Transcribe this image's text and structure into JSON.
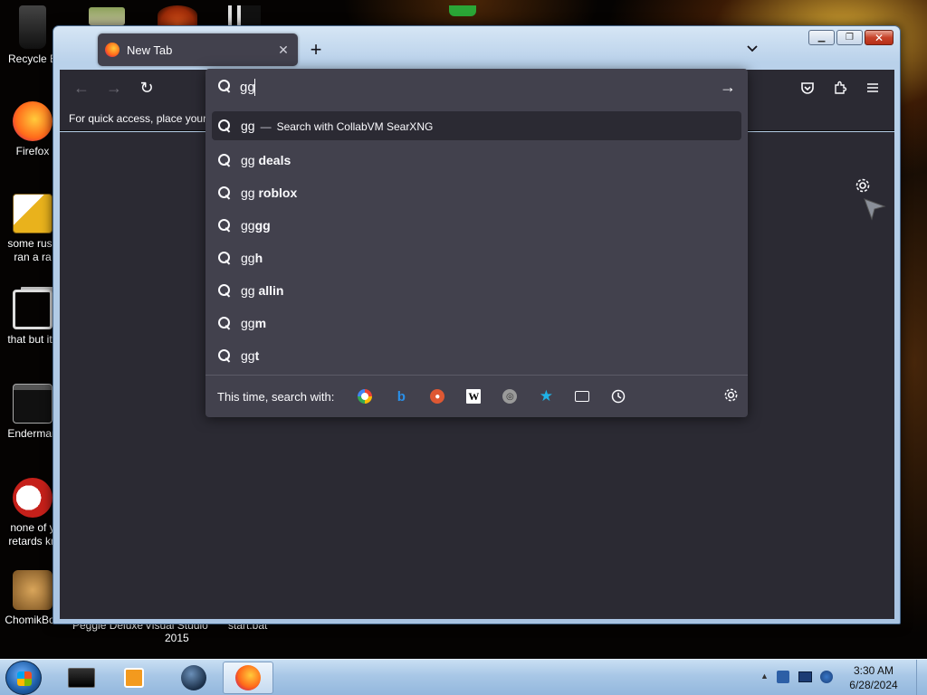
{
  "desktop": {
    "icons": [
      {
        "label_line1": "Recycle B",
        "label_line2": ""
      },
      {
        "label_line1": "Firefox",
        "label_line2": ""
      },
      {
        "label_line1": "some russ",
        "label_line2": "ran a ra"
      },
      {
        "label_line1": "that but its",
        "label_line2": ""
      },
      {
        "label_line1": "Enderman",
        "label_line2": ""
      },
      {
        "label_line1": "none of y",
        "label_line2": "retards kn"
      },
      {
        "label_line1": "ChomikBox",
        "label_line2": ""
      }
    ],
    "partial_labels": [
      "Peggle Deluxe",
      "Visual Studio",
      "2015",
      "start.bat"
    ]
  },
  "browser": {
    "tab_title": "New Tab",
    "tab_close": "✕",
    "new_tab": "+",
    "list_tabs": "⌄",
    "bookmarks_text": "For quick access, place your b",
    "nav": {
      "back": "←",
      "forward": "→",
      "reload": "↻"
    }
  },
  "urlbar": {
    "value": "gg",
    "go": "→",
    "results": [
      {
        "typed": "gg",
        "suffix": "",
        "dash": "—",
        "action": "Search with CollabVM SearXNG",
        "selected": true
      },
      {
        "typed": "gg ",
        "suffix": "deals"
      },
      {
        "typed": "gg ",
        "suffix": "roblox"
      },
      {
        "typed": "gg",
        "suffix": "gg"
      },
      {
        "typed": "gg",
        "suffix": "h"
      },
      {
        "typed": "gg ",
        "suffix": "allin"
      },
      {
        "typed": "gg",
        "suffix": "m"
      },
      {
        "typed": "gg",
        "suffix": "t"
      }
    ],
    "oneoff_label": "This time, search with:",
    "engines": [
      "google-icon",
      "bing-icon",
      "duckduckgo-icon",
      "wikipedia-icon",
      "searxng-icon",
      "bookmarks-star-icon",
      "tabs-icon",
      "history-icon"
    ]
  },
  "taskbar": {
    "time": "3:30 AM",
    "date": "6/28/2024",
    "tray_arrow": "▲"
  },
  "colors": {
    "toolbar": "#2b2a33",
    "popup": "#42414d",
    "text": "#fbfbfe",
    "accent_firefox": "#ff7139"
  }
}
